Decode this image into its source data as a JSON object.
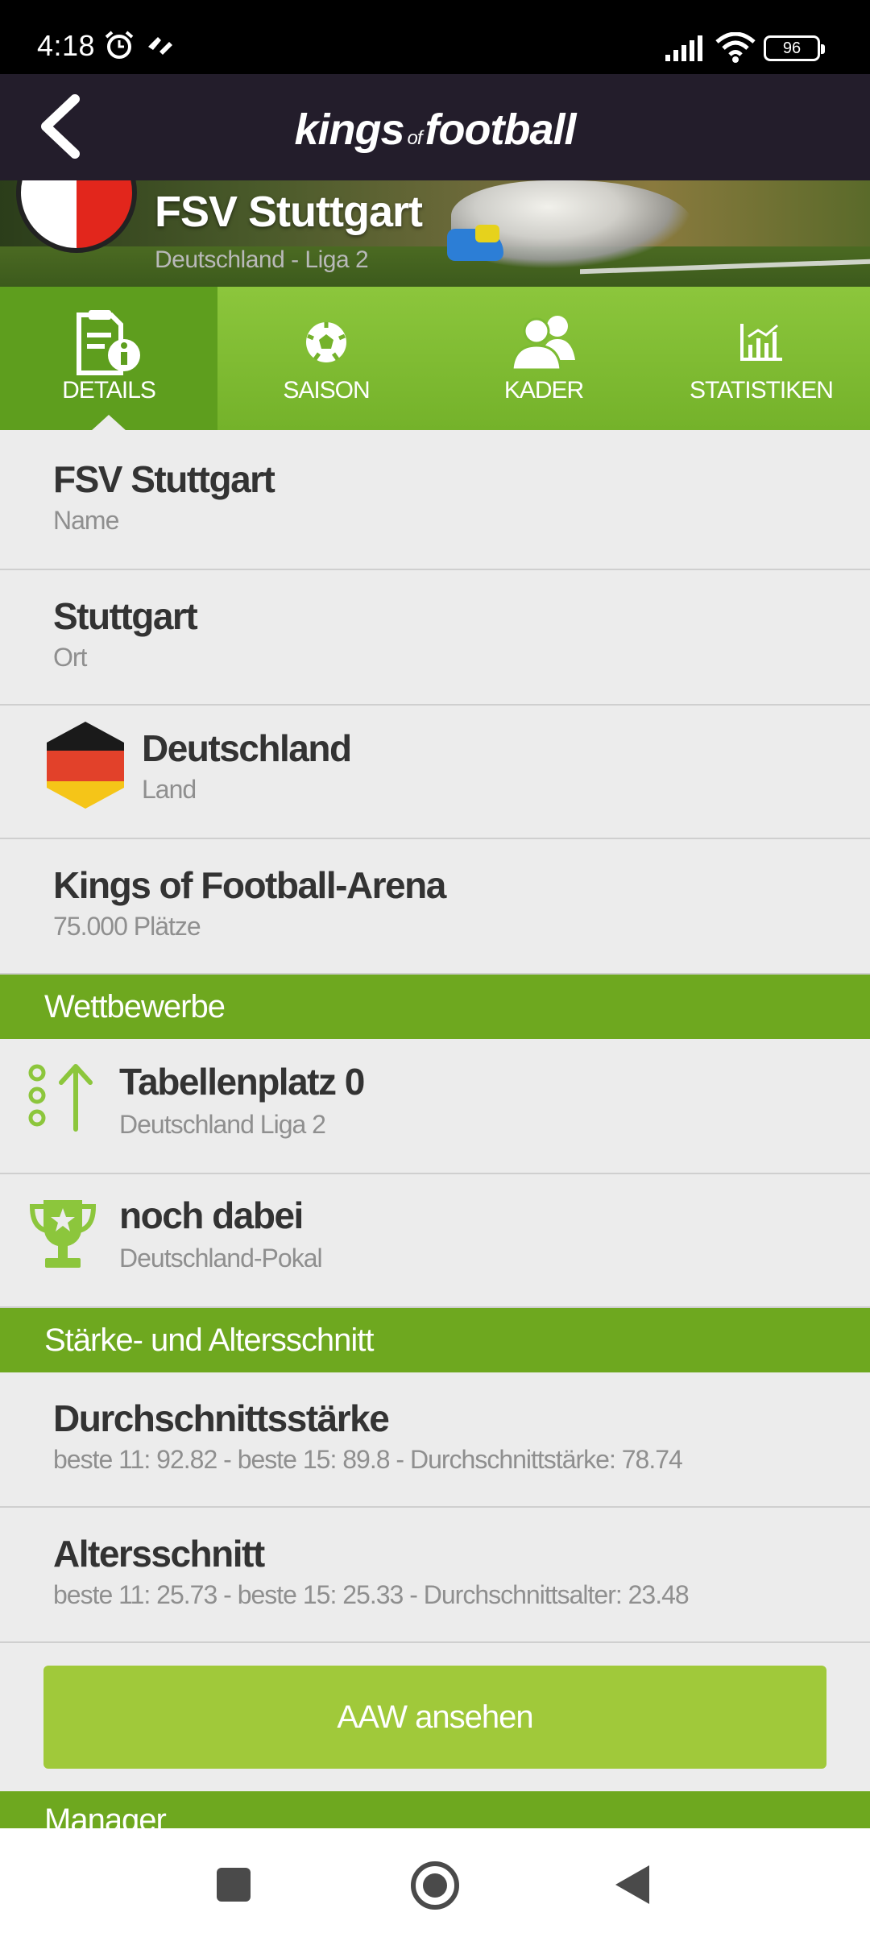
{
  "status_bar": {
    "time": "4:18",
    "battery": "96"
  },
  "app": {
    "logo_main": "kings",
    "logo_of": "of",
    "logo_end": "football"
  },
  "team": {
    "name": "FSV Stuttgart",
    "league": "Deutschland - Liga 2"
  },
  "tabs": [
    {
      "label": "DETAILS",
      "icon": "details-icon",
      "active": true
    },
    {
      "label": "SAISON",
      "icon": "soccer-ball-icon"
    },
    {
      "label": "KADER",
      "icon": "players-icon"
    },
    {
      "label": "STATISTIKEN",
      "icon": "bar-chart-icon"
    }
  ],
  "details": {
    "name_value": "FSV Stuttgart",
    "name_label": "Name",
    "city_value": "Stuttgart",
    "city_label": "Ort",
    "country_value": "Deutschland",
    "country_label": "Land",
    "stadium_value": "Kings of Football-Arena",
    "stadium_label": "75.000 Plätze"
  },
  "competitions": {
    "header": "Wettbewerbe",
    "league_value": "Tabellenplatz 0",
    "league_label": "Deutschland Liga 2",
    "cup_value": "noch dabei",
    "cup_label": "Deutschland-Pokal"
  },
  "strength": {
    "header": "Stärke- und Altersschnitt",
    "strength_value": "Durchschnittsstärke",
    "strength_label": "beste 11: 92.82 - beste 15: 89.8 - Durchschnittstärke: 78.74",
    "age_value": "Altersschnitt",
    "age_label": "beste 11: 25.73 - beste 15: 25.33 - Durchschnittsalter: 23.48"
  },
  "aaw_button": "AAW ansehen",
  "manager_header": "Manager",
  "colors": {
    "green": "#74b22a",
    "dark": "#231d2b",
    "accent_icon": "#8cc63c"
  }
}
